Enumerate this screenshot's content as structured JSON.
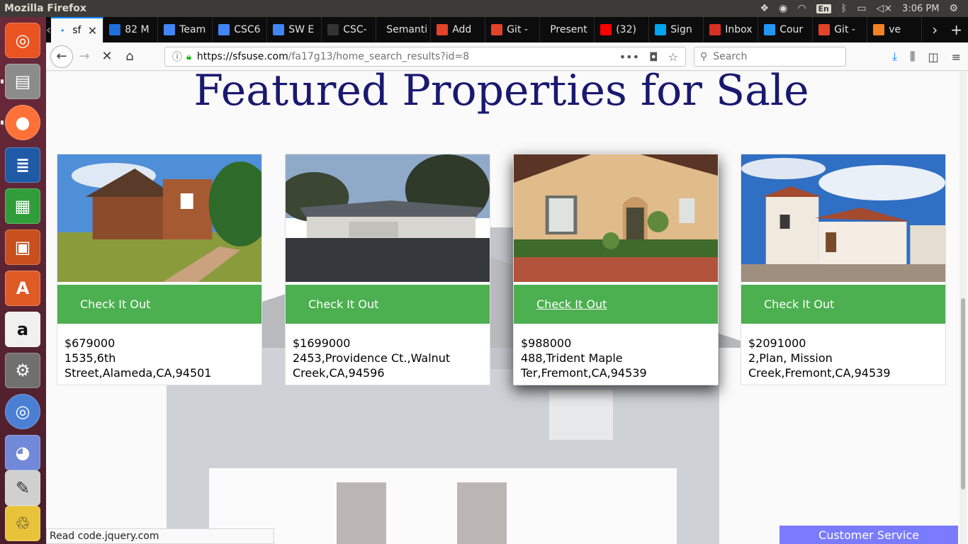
{
  "topbar": {
    "window_title": "Mozilla Firefox",
    "lang": "En",
    "time": "3:06 PM"
  },
  "tabs": [
    {
      "label": "sf",
      "fav_color": "#0a84ff",
      "active": true
    },
    {
      "label": "82 M",
      "fav_color": "#1e6fd9"
    },
    {
      "label": "Team",
      "fav_color": "#4285f4"
    },
    {
      "label": "CSC6",
      "fav_color": "#4285f4"
    },
    {
      "label": "SW E",
      "fav_color": "#4285f4"
    },
    {
      "label": "CSC-",
      "fav_color": "#333333"
    },
    {
      "label": "Semanti",
      "fav_color": ""
    },
    {
      "label": "Add",
      "fav_color": "#e24329"
    },
    {
      "label": "Git -",
      "fav_color": "#e24329"
    },
    {
      "label": "Present",
      "fav_color": ""
    },
    {
      "label": "(32)",
      "fav_color": "#ff0000"
    },
    {
      "label": "Sign",
      "fav_color": "#00a4ef"
    },
    {
      "label": "Inbox",
      "fav_color": "#d93025"
    },
    {
      "label": "Cour",
      "fav_color": "#2196f3"
    },
    {
      "label": "Git -",
      "fav_color": "#e24329"
    },
    {
      "label": "ve",
      "fav_color": "#f48024"
    }
  ],
  "navbar": {
    "url_domain": "https://sfsuse.com",
    "url_path": "/fa17g13/home_search_results?id=8",
    "search_placeholder": "Search"
  },
  "page": {
    "heading": "Featured Properties for Sale",
    "button_label": "Check It Out",
    "listings": [
      {
        "price": "$679000",
        "address": "1535,6th Street,Alameda,CA,94501"
      },
      {
        "price": "$1699000",
        "address": "2453,Providence Ct.,Walnut Creek,CA,94596"
      },
      {
        "price": "$988000",
        "address": "488,Trident Maple Ter,Fremont,CA,94539"
      },
      {
        "price": "$2091000",
        "address": "2,Plan, Mission Creek,Fremont,CA,94539"
      }
    ],
    "customer_service": "Customer Service"
  },
  "status_text": "Read code.jquery.com",
  "colors": {
    "accent_green": "#4caf50",
    "heading_navy": "#191970"
  }
}
